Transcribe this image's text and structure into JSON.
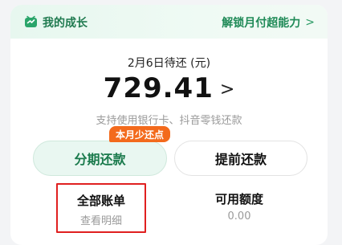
{
  "header": {
    "icon": "growth-badge-icon",
    "title": "我的成长",
    "link_label": "解锁月付超能力",
    "link_chevron": ">"
  },
  "bill": {
    "due_label": "2月6日待还 (元)",
    "amount": "729.41",
    "amount_chevron": ">",
    "support_text": "支持使用银行卡、抖音零钱还款"
  },
  "actions": {
    "installment_label": "分期还款",
    "installment_badge": "本月少还点",
    "prepay_label": "提前还款"
  },
  "stats": {
    "all_bills_title": "全部账单",
    "all_bills_sub": "查看明细",
    "available_credit_title": "可用额度",
    "available_credit_value": "0.00"
  },
  "colors": {
    "accent_green": "#1f8a57",
    "badge_orange": "#f36a1c",
    "highlight_red": "#e02020"
  }
}
